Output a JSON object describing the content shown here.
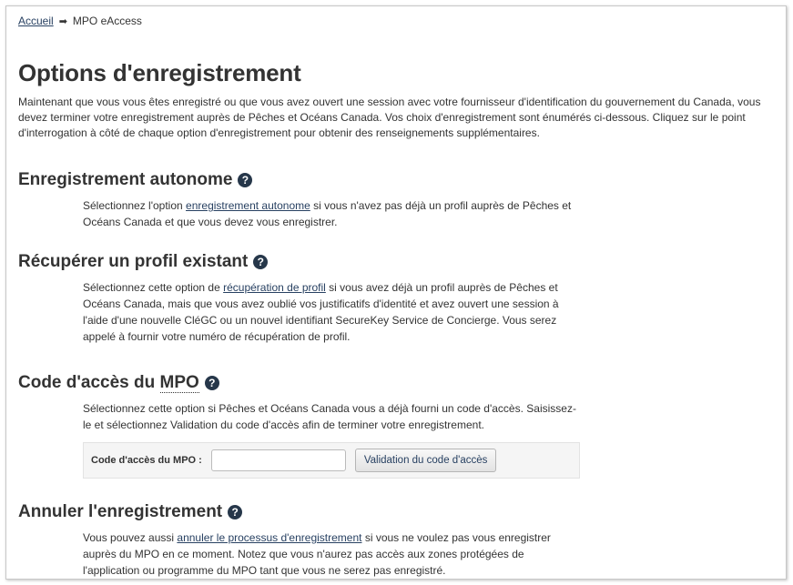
{
  "breadcrumb": {
    "home": "Accueil",
    "current": "MPO eAccess"
  },
  "page": {
    "title": "Options d'enregistrement",
    "intro": "Maintenant que vous vous êtes enregistré ou que vous avez ouvert une session avec votre fournisseur d'identification du gouvernement du Canada, vous devez terminer votre enregistrement auprès de Pêches et Océans Canada. Vos choix d'enregistrement sont énumérés ci-dessous. Cliquez sur le point d'interrogation à côté de chaque option d'enregistrement pour obtenir des renseignements supplémentaires."
  },
  "sections": {
    "self": {
      "heading": "Enregistrement autonome",
      "pre": "Sélectionnez l'option ",
      "link": "enregistrement autonome",
      "post": " si vous n'avez pas déjà un profil auprès de Pêches et Océans Canada et que vous devez vous enregistrer."
    },
    "recover": {
      "heading": "Récupérer un profil existant",
      "pre": "Sélectionnez cette option de ",
      "link": "récupération de profil",
      "post": " si vous avez déjà un profil auprès de Pêches et Océans Canada, mais que vous avez oublié vos justificatifs d'identité et avez ouvert une session à l'aide d'une nouvelle CléGC ou un nouvel identifiant SecureKey Service de Concierge. Vous serez appelé à fournir votre numéro de récupération de profil."
    },
    "access": {
      "heading_pre": "Code d'accès du ",
      "heading_abbr": "MPO",
      "text": "Sélectionnez cette option si Pêches et Océans Canada vous a déjà fourni un code d'accès. Saisissez-le et sélectionnez Validation du code d'accès afin de terminer votre enregistrement.",
      "field_label": "Code d'accès du MPO :",
      "field_value": "",
      "button": "Validation du code d'accès"
    },
    "cancel": {
      "heading": "Annuler l'enregistrement",
      "pre": "Vous pouvez aussi ",
      "link": "annuler le processus d'enregistrement",
      "post": " si vous ne voulez pas vous enregistrer auprès du MPO en ce moment. Notez que vous n'aurez pas accès aux zones protégées de l'application ou programme du MPO tant que vous ne serez pas enregistré."
    }
  },
  "icons": {
    "help": "?"
  },
  "colors": {
    "link": "#284162",
    "help_icon": "#26374a"
  }
}
